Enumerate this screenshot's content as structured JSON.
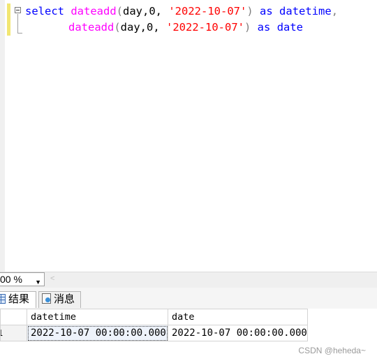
{
  "editor": {
    "line1": {
      "kw_select": "select",
      "fn": "dateadd",
      "args_open": "(day,0, ",
      "str": "'2022-10-07'",
      "paren_close": ")",
      "kw_as": "as",
      "alias": "datetime",
      "comma": ","
    },
    "line2": {
      "fn": "dateadd",
      "args_open": "(day,0, ",
      "str": "'2022-10-07'",
      "paren_close": ")",
      "kw_as": "as",
      "alias": "date"
    }
  },
  "zoom": {
    "value": "00 %"
  },
  "tabs": [
    {
      "label": "结果",
      "icon": "grid-icon"
    },
    {
      "label": "消息",
      "icon": "message-icon"
    }
  ],
  "results": {
    "columns": [
      "datetime",
      "date"
    ],
    "rows": [
      {
        "row_num": "1",
        "cells": [
          "2022-10-07 00:00:00.000",
          "2022-10-07 00:00:00.000"
        ]
      }
    ]
  },
  "watermark": "CSDN @heheda~",
  "colors": {
    "keyword": "#0000ff",
    "function": "#ff00ff",
    "string": "#ff0000",
    "change_bar": "#f2e672"
  }
}
